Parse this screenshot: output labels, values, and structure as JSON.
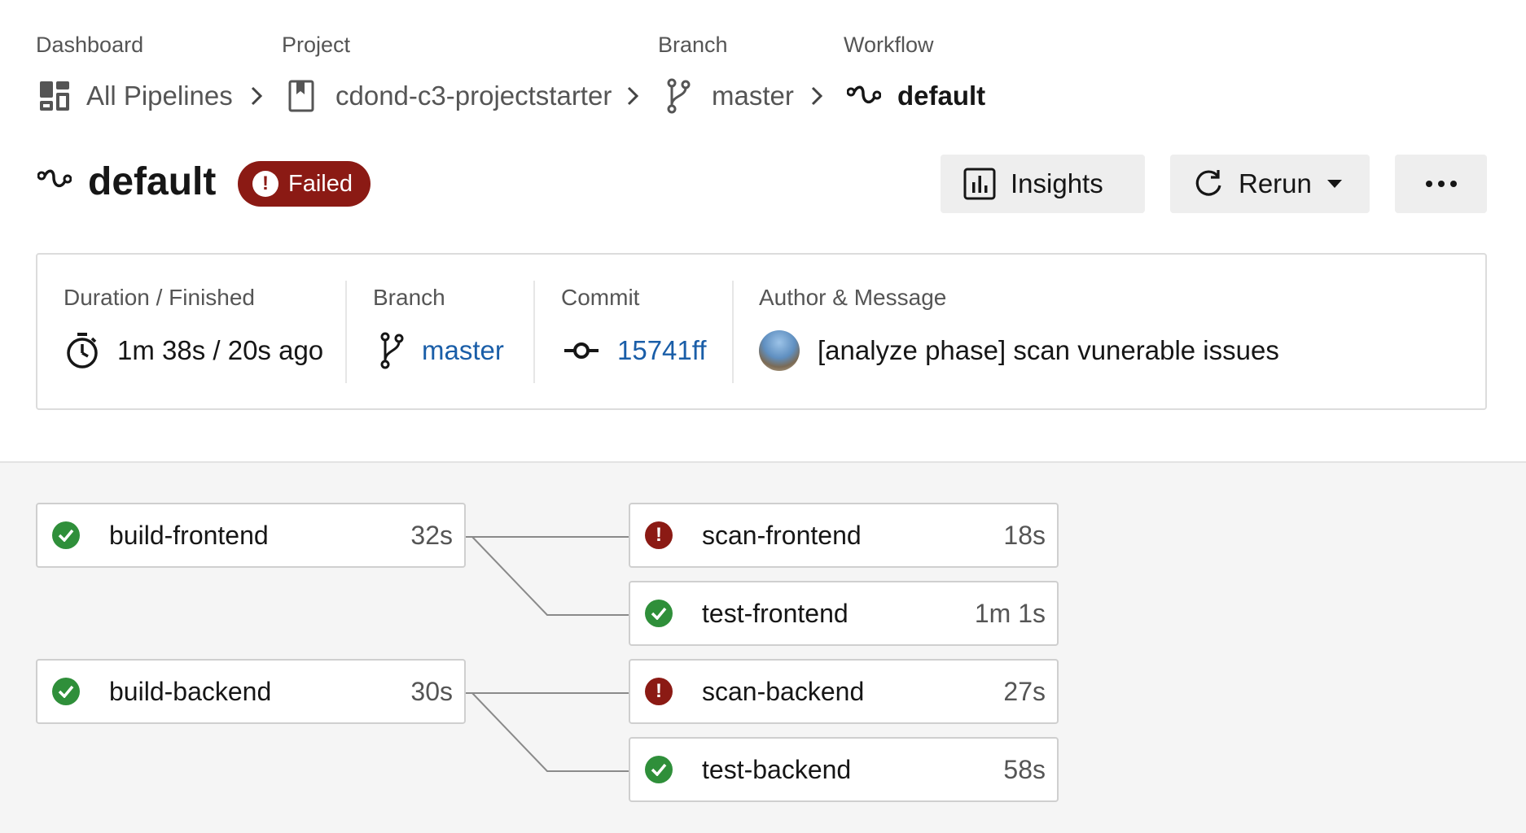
{
  "breadcrumb": {
    "items": [
      {
        "label": "Dashboard",
        "value": "All Pipelines",
        "icon": "dashboard-icon"
      },
      {
        "label": "Project",
        "value": "cdond-c3-projectstarter",
        "icon": "project-icon"
      },
      {
        "label": "Branch",
        "value": "master",
        "icon": "branch-icon"
      },
      {
        "label": "Workflow",
        "value": "default",
        "icon": "workflow-icon"
      }
    ]
  },
  "header": {
    "title": "default",
    "status": "Failed",
    "insights_label": "Insights",
    "rerun_label": "Rerun"
  },
  "summary": {
    "duration_label": "Duration / Finished",
    "duration_value": "1m 38s / 20s ago",
    "branch_label": "Branch",
    "branch_value": "master",
    "commit_label": "Commit",
    "commit_value": "15741ff",
    "author_label": "Author & Message",
    "message": "[analyze phase] scan vunerable issues"
  },
  "jobs": [
    {
      "name": "build-frontend",
      "duration": "32s",
      "status": "success"
    },
    {
      "name": "scan-frontend",
      "duration": "18s",
      "status": "failed"
    },
    {
      "name": "test-frontend",
      "duration": "1m 1s",
      "status": "success"
    },
    {
      "name": "build-backend",
      "duration": "30s",
      "status": "success"
    },
    {
      "name": "scan-backend",
      "duration": "27s",
      "status": "failed"
    },
    {
      "name": "test-backend",
      "duration": "58s",
      "status": "success"
    }
  ],
  "colors": {
    "failed": "#8b1a14",
    "success": "#2f8f3a",
    "link": "#1a5ea8"
  }
}
